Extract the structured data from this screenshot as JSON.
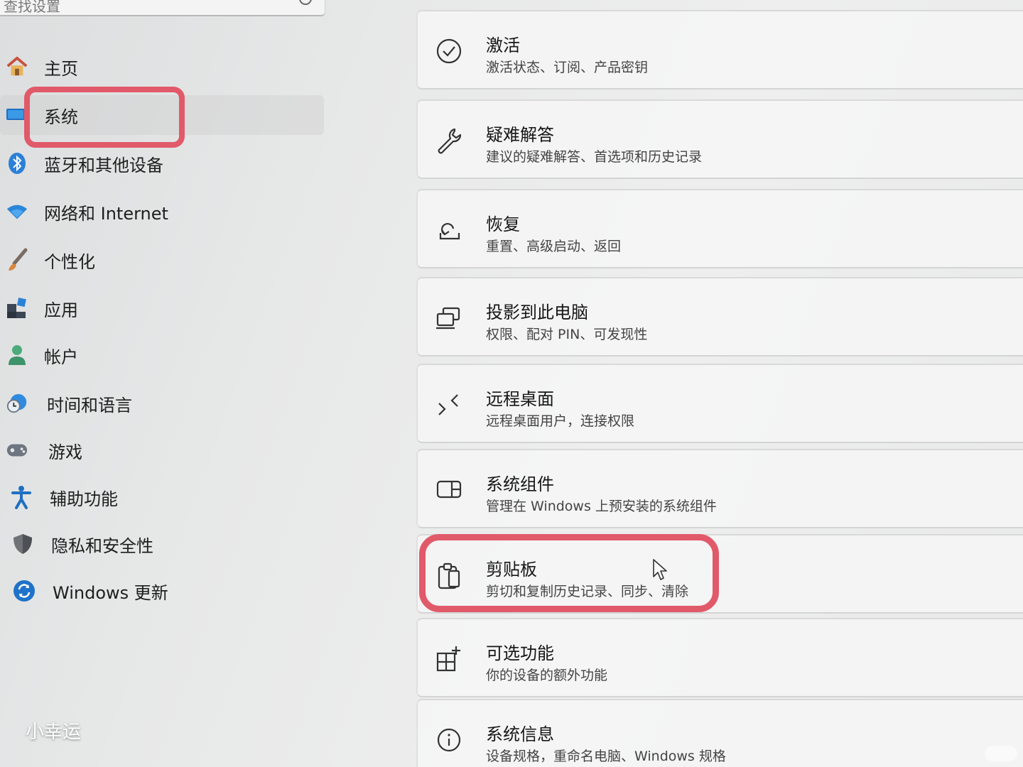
{
  "search": {
    "placeholder": "查找设置"
  },
  "sidebar": {
    "items": [
      {
        "label": "主页",
        "icon": "home-icon",
        "selected": false
      },
      {
        "label": "系统",
        "icon": "system-display-icon",
        "selected": true
      },
      {
        "label": "蓝牙和其他设备",
        "icon": "bluetooth-icon",
        "selected": false
      },
      {
        "label": "网络和 Internet",
        "icon": "wifi-icon",
        "selected": false
      },
      {
        "label": "个性化",
        "icon": "paintbrush-icon",
        "selected": false
      },
      {
        "label": "应用",
        "icon": "apps-icon",
        "selected": false
      },
      {
        "label": "帐户",
        "icon": "account-icon",
        "selected": false
      },
      {
        "label": "时间和语言",
        "icon": "globe-clock-icon",
        "selected": false
      },
      {
        "label": "游戏",
        "icon": "gamepad-icon",
        "selected": false
      },
      {
        "label": "辅助功能",
        "icon": "accessibility-icon",
        "selected": false
      },
      {
        "label": "隐私和安全性",
        "icon": "shield-icon",
        "selected": false
      },
      {
        "label": "Windows 更新",
        "icon": "update-icon",
        "selected": false
      }
    ]
  },
  "main": {
    "cards": [
      {
        "title": "激活",
        "desc": "激活状态、订阅、产品密钥",
        "icon": "check-circle-icon"
      },
      {
        "title": "疑难解答",
        "desc": "建议的疑难解答、首选项和历史记录",
        "icon": "wrench-icon"
      },
      {
        "title": "恢复",
        "desc": "重置、高级启动、返回",
        "icon": "recovery-icon"
      },
      {
        "title": "投影到此电脑",
        "desc": "权限、配对 PIN、可发现性",
        "icon": "project-icon"
      },
      {
        "title": "远程桌面",
        "desc": "远程桌面用户，连接权限",
        "icon": "remote-desktop-icon"
      },
      {
        "title": "系统组件",
        "desc": "管理在 Windows 上预安装的系统组件",
        "icon": "components-icon"
      },
      {
        "title": "剪贴板",
        "desc": "剪切和复制历史记录、同步、清除",
        "icon": "clipboard-icon"
      },
      {
        "title": "可选功能",
        "desc": "你的设备的额外功能",
        "icon": "optional-features-icon"
      },
      {
        "title": "系统信息",
        "desc": "设备规格，重命名电脑、Windows 规格",
        "icon": "info-icon"
      }
    ]
  },
  "overlay": {
    "watermark": "小幸运",
    "highlight_color": "#e15a6a"
  }
}
